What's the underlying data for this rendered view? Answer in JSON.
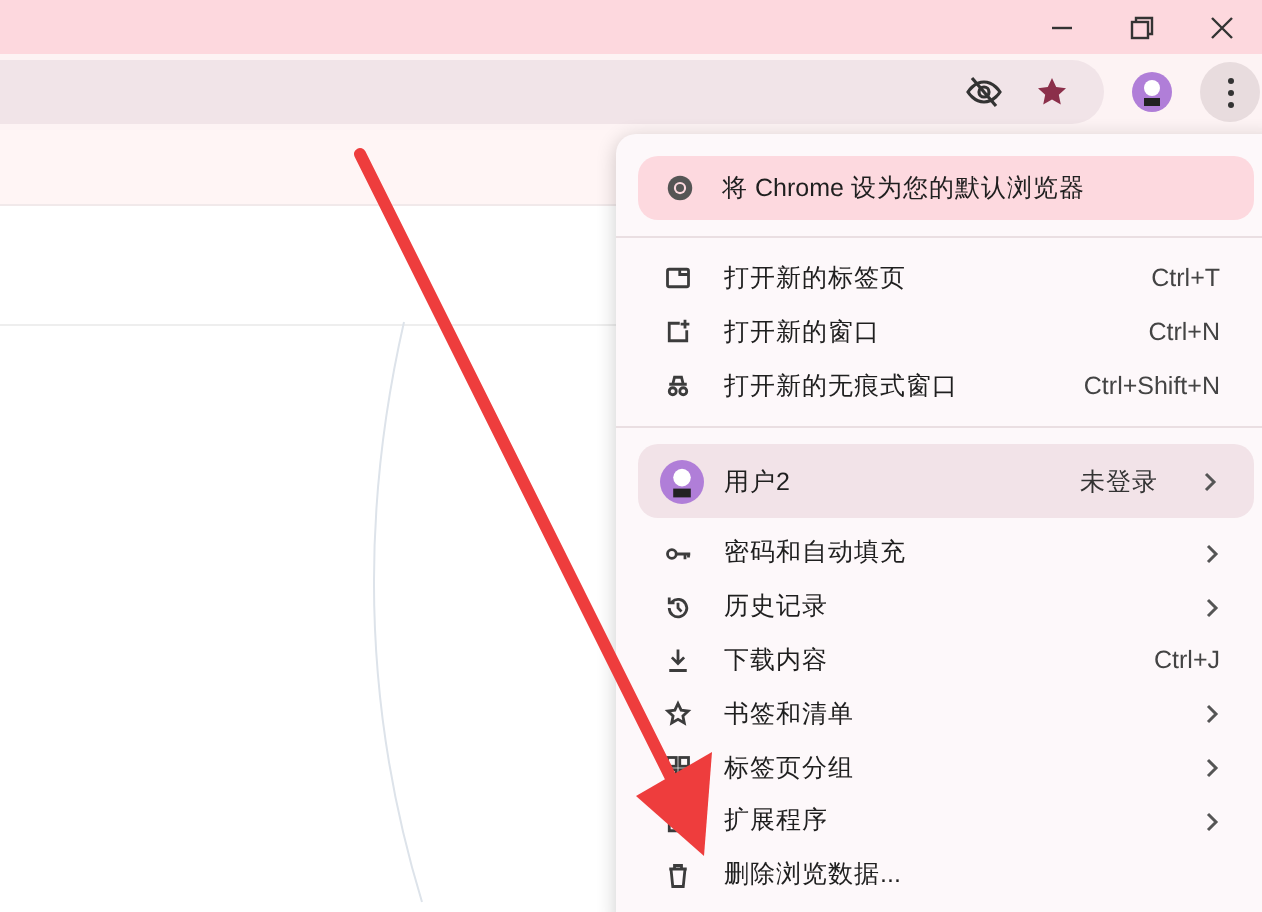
{
  "menu": {
    "promo": {
      "label": "将 Chrome 设为您的默认浏览器"
    },
    "groups": [
      [
        {
          "kind": "new-tab",
          "label": "打开新的标签页",
          "shortcut": "Ctrl+T",
          "submenu": false
        },
        {
          "kind": "new-window",
          "label": "打开新的窗口",
          "shortcut": "Ctrl+N",
          "submenu": false
        },
        {
          "kind": "incognito",
          "label": "打开新的无痕式窗口",
          "shortcut": "Ctrl+Shift+N",
          "submenu": false
        }
      ],
      [
        {
          "kind": "password",
          "label": "密码和自动填充",
          "submenu": true
        },
        {
          "kind": "history",
          "label": "历史记录",
          "submenu": true
        },
        {
          "kind": "download",
          "label": "下载内容",
          "shortcut": "Ctrl+J",
          "submenu": false
        },
        {
          "kind": "bookmark",
          "label": "书签和清单",
          "submenu": true
        },
        {
          "kind": "tab-group",
          "label": "标签页分组",
          "submenu": true
        },
        {
          "kind": "extension",
          "label": "扩展程序",
          "submenu": true
        },
        {
          "kind": "delete",
          "label": "删除浏览数据...",
          "submenu": false
        }
      ]
    ],
    "profile": {
      "name": "用户2",
      "status": "未登录",
      "submenu": true
    }
  }
}
